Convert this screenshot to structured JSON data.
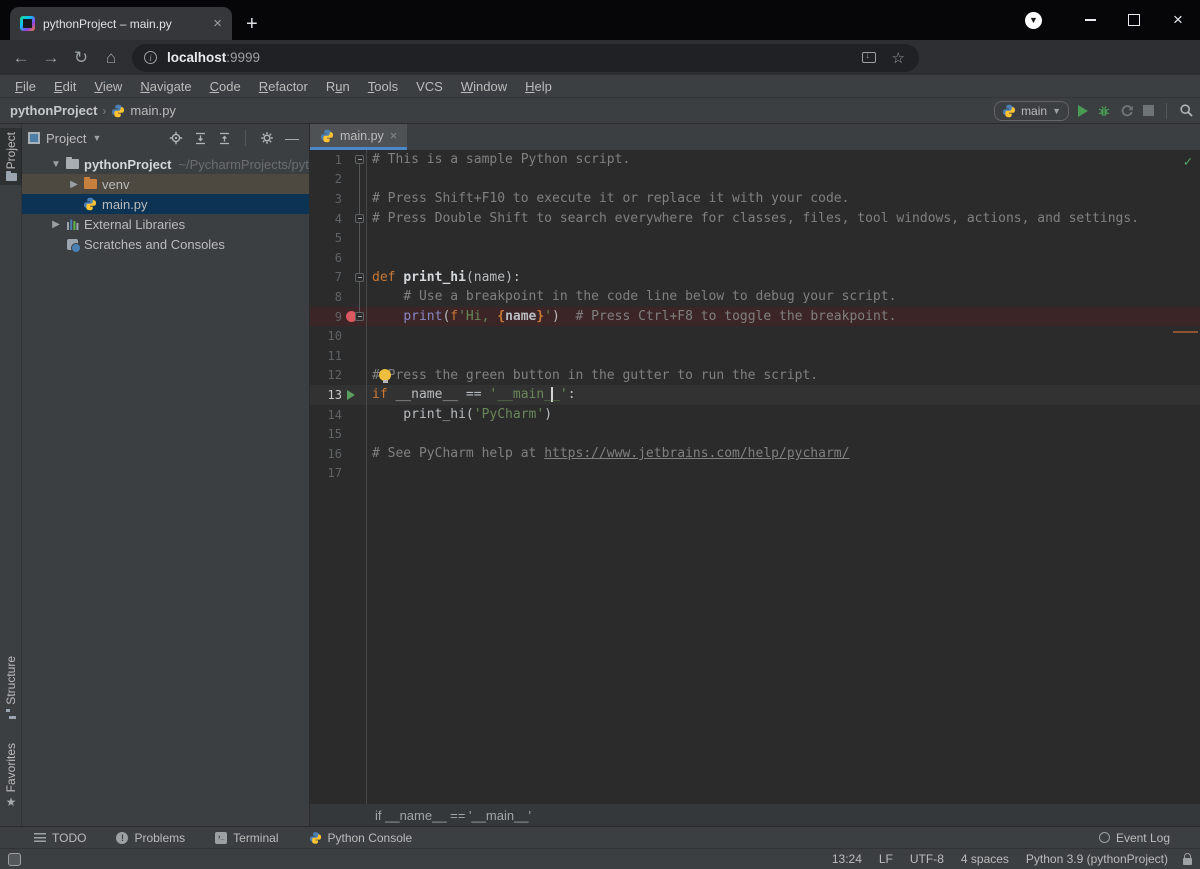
{
  "browser": {
    "tab_title": "pythonProject – main.py",
    "new_tab_label": "+",
    "url_host": "localhost",
    "url_port": ":9999"
  },
  "menu": {
    "items": [
      {
        "label": "File",
        "u": 0
      },
      {
        "label": "Edit",
        "u": 0
      },
      {
        "label": "View",
        "u": 0
      },
      {
        "label": "Navigate",
        "u": 0
      },
      {
        "label": "Code",
        "u": 0
      },
      {
        "label": "Refactor",
        "u": 0
      },
      {
        "label": "Run",
        "u": 1
      },
      {
        "label": "Tools",
        "u": 0
      },
      {
        "label": "VCS",
        "u": -1
      },
      {
        "label": "Window",
        "u": 0
      },
      {
        "label": "Help",
        "u": 0
      }
    ]
  },
  "navbar": {
    "project": "pythonProject",
    "file": "main.py",
    "run_config": "main"
  },
  "toolwindow_stripes": {
    "project_label": "Project",
    "structure_label": "Structure",
    "favorites_label": "Favorites"
  },
  "project_panel": {
    "title": "Project",
    "tree": [
      {
        "label": "pythonProject",
        "path": "~/PycharmProjects/pythonProje",
        "icon": "folder",
        "chevron": "down",
        "indent": 0,
        "bold": true
      },
      {
        "label": "venv",
        "icon": "folder-excluded",
        "chevron": "right",
        "indent": 1,
        "state": "highlight"
      },
      {
        "label": "main.py",
        "icon": "python-file",
        "chevron": "none",
        "indent": 1,
        "state": "selected"
      },
      {
        "label": "External Libraries",
        "icon": "external-libraries",
        "chevron": "right",
        "indent": 0
      },
      {
        "label": "Scratches and Consoles",
        "icon": "scratches",
        "chevron": "none",
        "indent": 0
      }
    ]
  },
  "editor": {
    "tab_label": "main.py",
    "breadcrumb": "if __name__ == '__main__'",
    "lines": [
      {
        "n": 1,
        "fold": true,
        "tokens": [
          {
            "s": "# This is a sample Python script.",
            "c": "cmt"
          }
        ]
      },
      {
        "n": 2,
        "tokens": []
      },
      {
        "n": 3,
        "tokens": [
          {
            "s": "# Press Shift+F10 to execute it or replace it with your code.",
            "c": "cmt"
          }
        ]
      },
      {
        "n": 4,
        "fold": true,
        "tokens": [
          {
            "s": "# Press Double Shift to search everywhere for classes, files, tool windows, actions, and settings.",
            "c": "cmt"
          }
        ]
      },
      {
        "n": 5,
        "tokens": []
      },
      {
        "n": 6,
        "tokens": []
      },
      {
        "n": 7,
        "fold": true,
        "tokens": [
          {
            "s": "def ",
            "c": "kw"
          },
          {
            "s": "print_hi",
            "c": "fn"
          },
          {
            "s": "(name):",
            "c": "txt"
          }
        ]
      },
      {
        "n": 8,
        "tokens": [
          {
            "s": "    ",
            "c": "txt"
          },
          {
            "s": "# Use a breakpoint in the code line below to debug your script.",
            "c": "cmt"
          }
        ]
      },
      {
        "n": 9,
        "breakpoint": true,
        "fold": true,
        "tokens": [
          {
            "s": "    ",
            "c": "txt"
          },
          {
            "s": "print",
            "c": "bi"
          },
          {
            "s": "(",
            "c": "txt"
          },
          {
            "s": "f",
            "c": "kw"
          },
          {
            "s": "'Hi, ",
            "c": "str"
          },
          {
            "s": "{",
            "c": "brace"
          },
          {
            "s": "name",
            "c": "bold"
          },
          {
            "s": "}",
            "c": "brace"
          },
          {
            "s": "'",
            "c": "str"
          },
          {
            "s": ")",
            "c": "txt"
          },
          {
            "s": "  ",
            "c": "txt"
          },
          {
            "s": "# Press Ctrl+F8 to toggle the breakpoint.",
            "c": "cmt"
          }
        ]
      },
      {
        "n": 10,
        "tokens": []
      },
      {
        "n": 11,
        "tokens": []
      },
      {
        "n": 12,
        "bulb": true,
        "tokens": [
          {
            "s": "# Press the green button in the gutter to run the script.",
            "c": "cmt"
          }
        ]
      },
      {
        "n": 13,
        "current": true,
        "run": true,
        "tokens": [
          {
            "s": "if ",
            "c": "kw"
          },
          {
            "s": "__name__ == ",
            "c": "txt"
          },
          {
            "s": "'__main_",
            "c": "str"
          },
          {
            "s": "",
            "c": "caret"
          },
          {
            "s": "_'",
            "c": "str"
          },
          {
            "s": ":",
            "c": "txt"
          }
        ]
      },
      {
        "n": 14,
        "tokens": [
          {
            "s": "    print_hi(",
            "c": "txt"
          },
          {
            "s": "'PyCharm'",
            "c": "str"
          },
          {
            "s": ")",
            "c": "txt"
          }
        ]
      },
      {
        "n": 15,
        "tokens": []
      },
      {
        "n": 16,
        "tokens": [
          {
            "s": "# See PyCharm help at ",
            "c": "cmt"
          },
          {
            "s": "https://www.jetbrains.com/help/pycharm/",
            "c": "link"
          }
        ]
      },
      {
        "n": 17,
        "tokens": []
      }
    ]
  },
  "bottom_bar": {
    "items": [
      {
        "label": "TODO",
        "icon": "todo"
      },
      {
        "label": "Problems",
        "icon": "problems"
      },
      {
        "label": "Terminal",
        "icon": "terminal"
      },
      {
        "label": "Python Console",
        "icon": "python"
      }
    ],
    "right": {
      "label": "Event Log",
      "icon": "event-log"
    }
  },
  "status_bar": {
    "items": [
      {
        "label": "13:24",
        "name": "caret-position"
      },
      {
        "label": "LF",
        "name": "line-separator"
      },
      {
        "label": "UTF-8",
        "name": "file-encoding"
      },
      {
        "label": "4 spaces",
        "name": "indent-style"
      },
      {
        "label": "Python 3.9 (pythonProject)",
        "name": "interpreter"
      }
    ]
  },
  "colors": {
    "accent_blue": "#4a88c7",
    "tree_selection": "#0d3354",
    "excluded_row": "#4d4941",
    "breakpoint_line": "#3b2526",
    "keyword": "#cc7832",
    "string": "#6a8759",
    "comment": "#808080",
    "builtin": "#8888c6",
    "run_green": "#499c54",
    "breakpoint_red": "#db5860"
  }
}
